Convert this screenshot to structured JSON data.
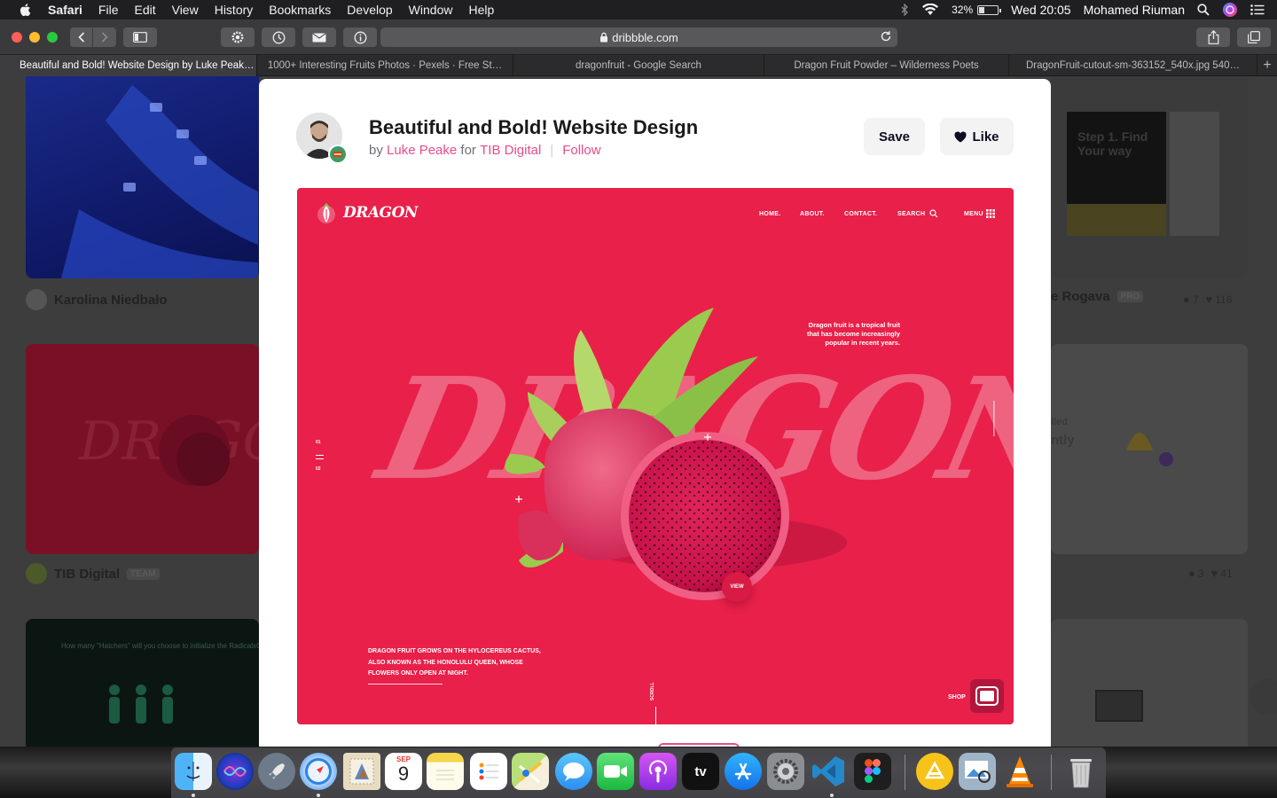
{
  "menubar": {
    "app": "Safari",
    "items": [
      "File",
      "Edit",
      "View",
      "History",
      "Bookmarks",
      "Develop",
      "Window",
      "Help"
    ],
    "battery_percent": "32%",
    "battery_level": 0.32,
    "clock": "Wed 20:05",
    "user": "Mohamed Riuman"
  },
  "toolbar": {
    "url": "dribbble.com",
    "icons": [
      "back-icon",
      "forward-icon",
      "sidebar-icon",
      "settings-icon",
      "history-icon",
      "mail-icon",
      "info-icon",
      "lock-icon",
      "reload-icon",
      "share-icon",
      "tabs-overview-icon"
    ]
  },
  "tabs": [
    {
      "label": "Beautiful and Bold! Website Design by Luke Peak…",
      "active": true
    },
    {
      "label": "1000+ Interesting Fruits Photos · Pexels · Free St…",
      "active": false
    },
    {
      "label": "dragonfruit - Google Search",
      "active": false
    },
    {
      "label": "Dragon Fruit Powder – Wilderness Poets",
      "active": false
    },
    {
      "label": "DragonFruit-cutout-sm-363152_540x.jpg 540…",
      "active": false
    }
  ],
  "background_grid": {
    "author1": "Karolina Niedbało",
    "author2": "TIB Digital",
    "author2_badge": "TEAM",
    "author3_partial": "e Rogava",
    "author3_badge": "PRO",
    "stats3": {
      "comments": "7",
      "likes": "116"
    },
    "stats4": {
      "comments": "3",
      "likes": "41"
    },
    "card_text_step": "Step 1. Find Your way",
    "card_text_found": "lled",
    "card_text_ntly": "ntly",
    "card_text_hatchers": "How many \"Hatchers\" will you choose to initialize the RadicalxChange Comm"
  },
  "modal": {
    "title": "Beautiful and Bold! Website Design",
    "by": "by",
    "author": "Luke Peake",
    "for": "for",
    "team": "TIB Digital",
    "follow": "Follow",
    "save_label": "Save",
    "like_label": "Like"
  },
  "artwork": {
    "logo": "DRAGON",
    "nav": [
      "HOME.",
      "ABOUT.",
      "CONTACT.",
      "SEARCH",
      "MENU"
    ],
    "side_numbers": [
      "01",
      "02"
    ],
    "big_word": "DRAGON",
    "tagline_lines": [
      "Dragon fruit is a tropical fruit",
      "that has become increasingly",
      "popular in recent years."
    ],
    "caption_lines": [
      "DRAGON FRUIT GROWS ON THE HYLOCEREUS CACTUS,",
      "ALSO KNOWN AS THE HONOLULU QUEEN, WHOSE",
      "FLOWERS ONLY OPEN AT NIGHT."
    ],
    "scroll_label": "SCROLL",
    "view_label": "VIEW",
    "shop_label": "SHOP",
    "colors": {
      "background": "#e8204a",
      "fruit_flesh": "#d4174a",
      "leaf": "#9acb4f"
    }
  },
  "dock": {
    "apps": [
      "Finder",
      "Siri",
      "Launchpad",
      "Safari",
      "Mail Stamp",
      "Calendar",
      "Notes",
      "Reminders",
      "Maps",
      "Messages",
      "FaceTime",
      "Podcasts",
      "Apple TV",
      "App Store",
      "System Preferences",
      "Visual Studio Code",
      "Figma",
      "Transmit",
      "Preview",
      "VLC",
      "Trash"
    ],
    "calendar_month": "SEP",
    "calendar_day": "9",
    "tv_label": "tv"
  }
}
